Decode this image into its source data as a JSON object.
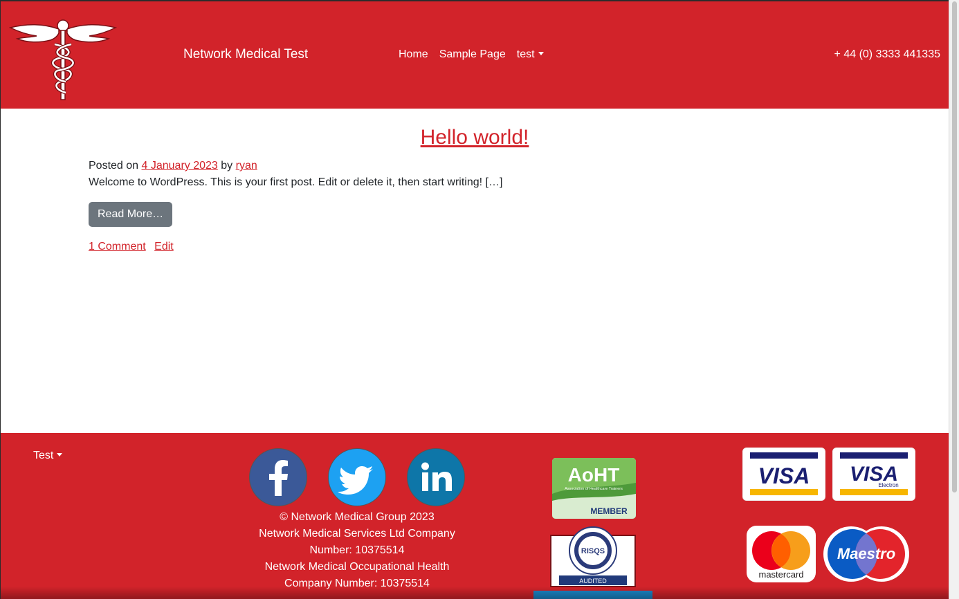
{
  "header": {
    "site_title": "Network Medical Test",
    "nav": [
      {
        "label": "Home"
      },
      {
        "label": "Sample Page"
      },
      {
        "label": "test"
      }
    ],
    "phone": "+ 44 (0) 3333 441335"
  },
  "post": {
    "title": "Hello world!",
    "posted_on_label": "Posted on",
    "date": "4 January 2023",
    "by_label": "by",
    "author": "ryan",
    "excerpt": "Welcome to WordPress. This is your first post. Edit or delete it, then start writing! […]",
    "read_more": "Read More…",
    "comments_link": "1 Comment",
    "edit_link": "Edit"
  },
  "footer": {
    "menu_label": "Test",
    "social": [
      "facebook-icon",
      "twitter-icon",
      "linkedin-icon"
    ],
    "copyright_lines": [
      "© Network Medical Group 2023",
      "Network Medical Services Ltd Company",
      "Number: 10375514",
      "Network Medical Occupational Health",
      "Company Number: 10375514"
    ],
    "badges": {
      "aoht": {
        "name": "AoHT",
        "subtitle": "Association of Healthcare Trainers",
        "label": "MEMBER"
      },
      "risqs": {
        "name": "RISQS",
        "ring": "RAILWAY INDUSTRY SUPPLIER QUALIFICATION SCHEME",
        "label": "AUDITED"
      }
    },
    "payment_cards": [
      "VISA",
      "VISA Electron",
      "mastercard",
      "Maestro"
    ]
  },
  "colors": {
    "brand_red": "#d2232a",
    "button_grey": "#6c757d",
    "facebook": "#3b5998",
    "twitter": "#1da1f2",
    "linkedin": "#0e76a8"
  }
}
